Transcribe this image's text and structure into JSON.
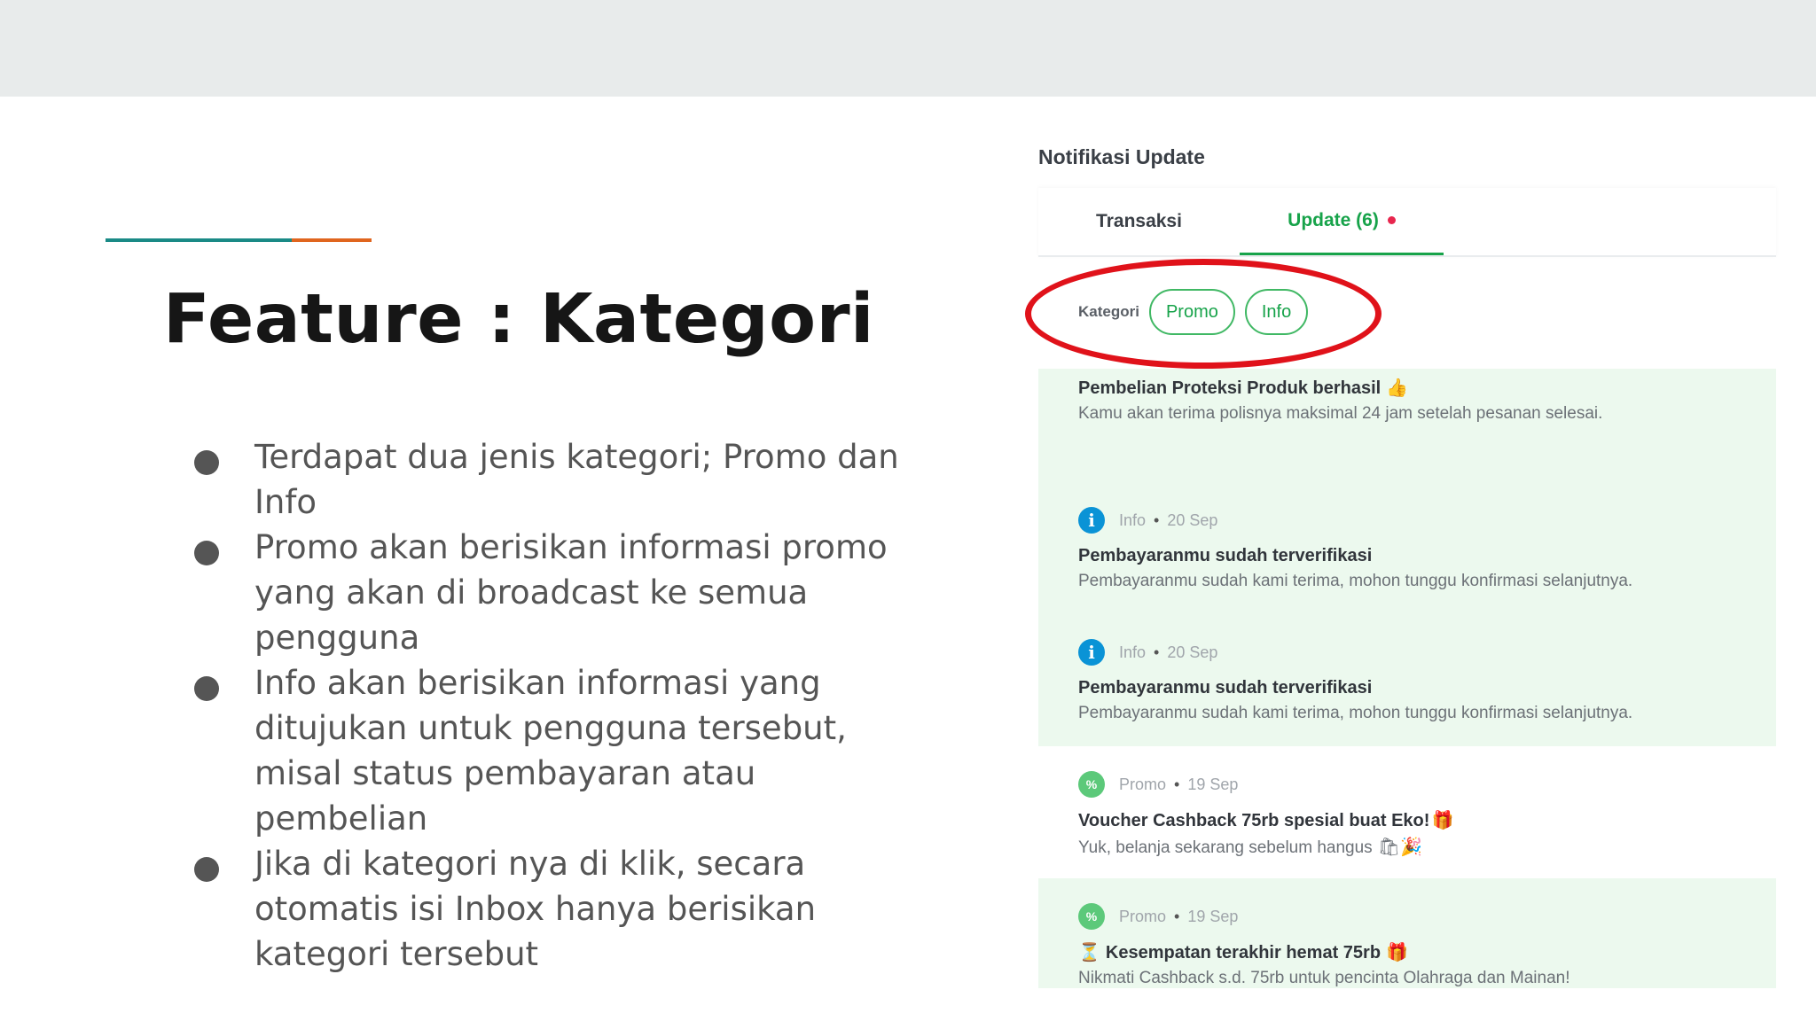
{
  "slide": {
    "title": "Feature : Kategori",
    "bullets": [
      "Terdapat dua jenis kategori; Promo dan Info",
      "Promo akan berisikan informasi promo yang akan di broadcast ke semua pengguna",
      "Info akan berisikan informasi yang ditujukan untuk pengguna tersebut, misal status pembayaran atau pembelian",
      "Jika di kategori nya di klik, secara otomatis isi Inbox hanya berisikan kategori tersebut"
    ]
  },
  "panel": {
    "title": "Notifikasi Update",
    "tabs": {
      "transaksi": "Transaksi",
      "update": "Update (6)"
    },
    "kategori": {
      "label": "Kategori",
      "chips": [
        "Promo",
        "Info"
      ]
    },
    "notifications": [
      {
        "title": "Pembelian Proteksi Produk berhasil",
        "title_emoji": "👍",
        "body": "Kamu akan terima polisnya maksimal 24 jam setelah pesanan selesai."
      },
      {
        "icon": "info-icon",
        "category": "Info",
        "date": "20 Sep",
        "title": "Pembayaranmu sudah terverifikasi",
        "body": "Pembayaranmu sudah kami terima, mohon tunggu konfirmasi selanjutnya."
      },
      {
        "icon": "info-icon",
        "category": "Info",
        "date": "20 Sep",
        "title": "Pembayaranmu sudah terverifikasi",
        "body": "Pembayaranmu sudah kami terima, mohon tunggu konfirmasi selanjutnya."
      },
      {
        "icon": "promo-icon",
        "category": "Promo",
        "date": "19 Sep",
        "title": "Voucher Cashback 75rb spesial buat Eko!",
        "title_emoji": "🎁",
        "body": "Yuk, belanja sekarang sebelum hangus",
        "body_emoji": "🛍🎉"
      },
      {
        "icon": "promo-icon",
        "category": "Promo",
        "date": "19 Sep",
        "title_prefix": "⏳",
        "title": "Kesempatan terakhir hemat 75rb",
        "title_emoji": "🎁",
        "body": "Nikmati Cashback s.d. 75rb untuk pencinta Olahraga dan Mainan!"
      }
    ]
  },
  "colors": {
    "brand_green": "#17a34a",
    "highlight_red": "#e0121a",
    "accent_teal": "#1a8a86",
    "accent_orange": "#e0651e"
  }
}
